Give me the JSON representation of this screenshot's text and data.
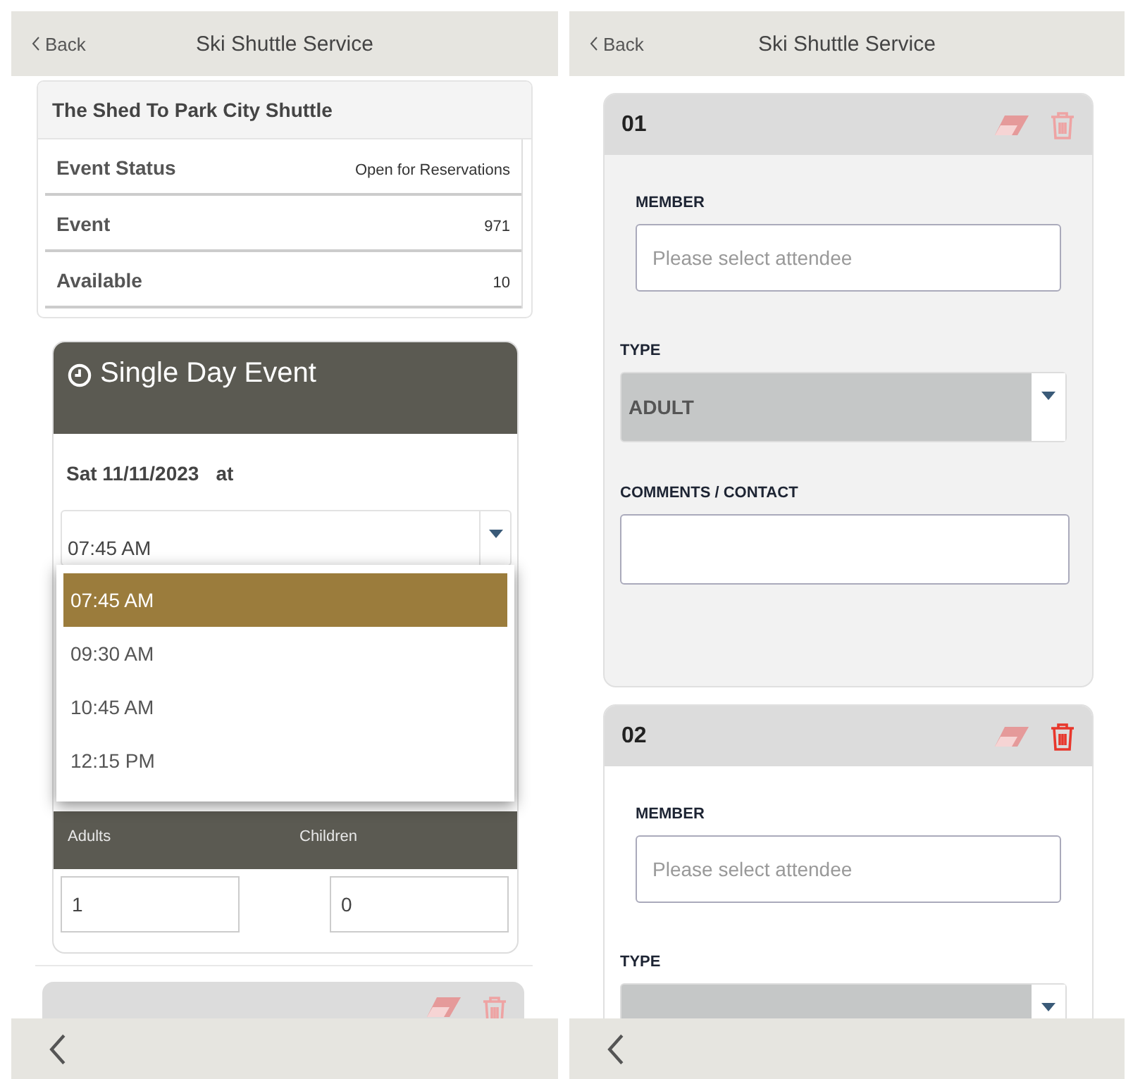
{
  "left_screen": {
    "header": {
      "back": "Back",
      "title": "Ski Shuttle Service"
    },
    "event_info": {
      "title": "The Shed To Park City Shuttle",
      "rows": [
        {
          "label": "Event Status",
          "value": "Open for Reservations"
        },
        {
          "label": "Event",
          "value": "971"
        },
        {
          "label": "Available",
          "value": "10"
        }
      ]
    },
    "schedule": {
      "title": "Single Day Event",
      "date": "Sat 11/11/2023",
      "at": "at",
      "time_select": {
        "value": "07:45 AM"
      },
      "time_options": [
        {
          "label": "07:45 AM",
          "selected": true
        },
        {
          "label": "09:30 AM",
          "selected": false
        },
        {
          "label": "10:45 AM",
          "selected": false
        },
        {
          "label": "12:15 PM",
          "selected": false
        }
      ],
      "quantities": [
        {
          "label": "Adults",
          "value": "1"
        },
        {
          "label": "Children",
          "value": "0"
        }
      ]
    },
    "attendee_preview": {
      "delete_enabled": false
    }
  },
  "right_screen": {
    "header": {
      "back": "Back",
      "title": "Ski Shuttle Service"
    },
    "attendees": [
      {
        "number": "01",
        "greyed": true,
        "delete_enabled": false,
        "member": {
          "label": "MEMBER",
          "placeholder": "Please select attendee"
        },
        "type": {
          "label": "TYPE",
          "value": "ADULT"
        },
        "comments": {
          "label": "COMMENTS / CONTACT"
        }
      },
      {
        "number": "02",
        "greyed": false,
        "delete_enabled": true,
        "member": {
          "label": "MEMBER",
          "placeholder": "Please select attendee"
        },
        "type": {
          "label": "TYPE"
        }
      }
    ]
  }
}
